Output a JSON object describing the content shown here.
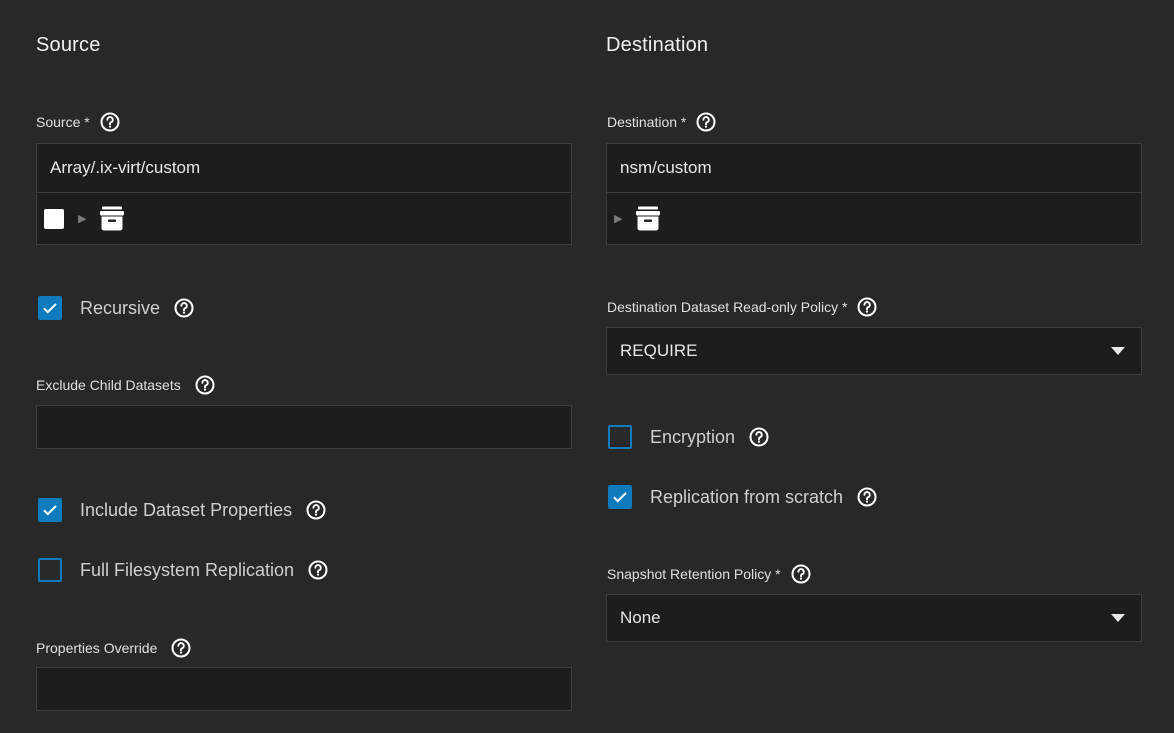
{
  "source": {
    "section_title": "Source",
    "source_field": {
      "label": "Source *",
      "value": "Array/.ix-virt/custom"
    },
    "recursive": {
      "label": "Recursive",
      "checked": true
    },
    "exclude_child": {
      "label": "Exclude Child Datasets",
      "value": ""
    },
    "include_props": {
      "label": "Include Dataset Properties",
      "checked": true
    },
    "full_fs": {
      "label": "Full Filesystem Replication",
      "checked": false
    },
    "props_override": {
      "label": "Properties Override",
      "value": ""
    }
  },
  "destination": {
    "section_title": "Destination",
    "dest_field": {
      "label": "Destination *",
      "value": "nsm/custom"
    },
    "readonly_policy": {
      "label": "Destination Dataset Read-only Policy *",
      "value": "REQUIRE"
    },
    "encryption": {
      "label": "Encryption",
      "checked": false
    },
    "from_scratch": {
      "label": "Replication from scratch",
      "checked": true
    },
    "retention": {
      "label": "Snapshot Retention Policy *",
      "value": "None"
    }
  },
  "colors": {
    "background": "#282828",
    "input_background": "#1d1d1d",
    "accent": "#0f7bbd"
  },
  "icons": {
    "help": "help-circle-icon",
    "folder": "dataset-folder-icon",
    "expand": "triangle-right-icon",
    "dropdown": "caret-down-icon",
    "check": "check-icon"
  }
}
